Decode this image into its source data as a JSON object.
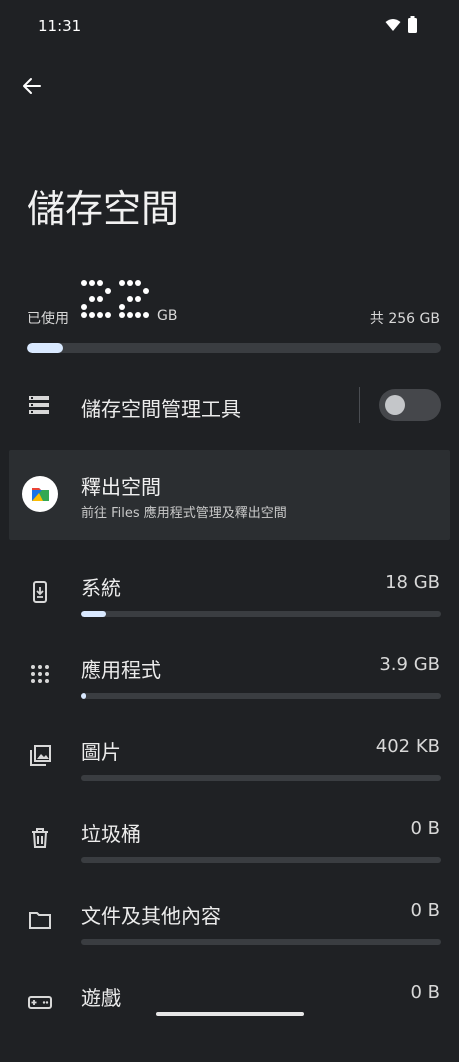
{
  "status": {
    "time": "11:31"
  },
  "header": {
    "title": "儲存空間"
  },
  "usage": {
    "used_label": "已使用",
    "used_value": "22",
    "used_unit": "GB",
    "total": "共 256 GB",
    "fraction": 0.086
  },
  "manager": {
    "label": "儲存空間管理工具",
    "enabled": false
  },
  "free_up": {
    "title": "釋出空間",
    "subtitle": "前往 Files 應用程式管理及釋出空間"
  },
  "categories": [
    {
      "label": "系統",
      "size": "18 GB",
      "fraction": 0.07,
      "icon": "phone-download-icon"
    },
    {
      "label": "應用程式",
      "size": "3.9 GB",
      "fraction": 0.015,
      "icon": "apps-grid-icon"
    },
    {
      "label": "圖片",
      "size": "402 KB",
      "fraction": 0,
      "icon": "photo-library-icon"
    },
    {
      "label": "垃圾桶",
      "size": "0 B",
      "fraction": 0,
      "icon": "trash-icon"
    },
    {
      "label": "文件及其他內容",
      "size": "0 B",
      "fraction": 0,
      "icon": "folder-icon"
    },
    {
      "label": "遊戲",
      "size": "0 B",
      "fraction": 0,
      "icon": "gamepad-icon"
    }
  ],
  "colors": {
    "background": "#1f2124",
    "accent": "#d9e9ff",
    "track": "#3a3d41"
  }
}
